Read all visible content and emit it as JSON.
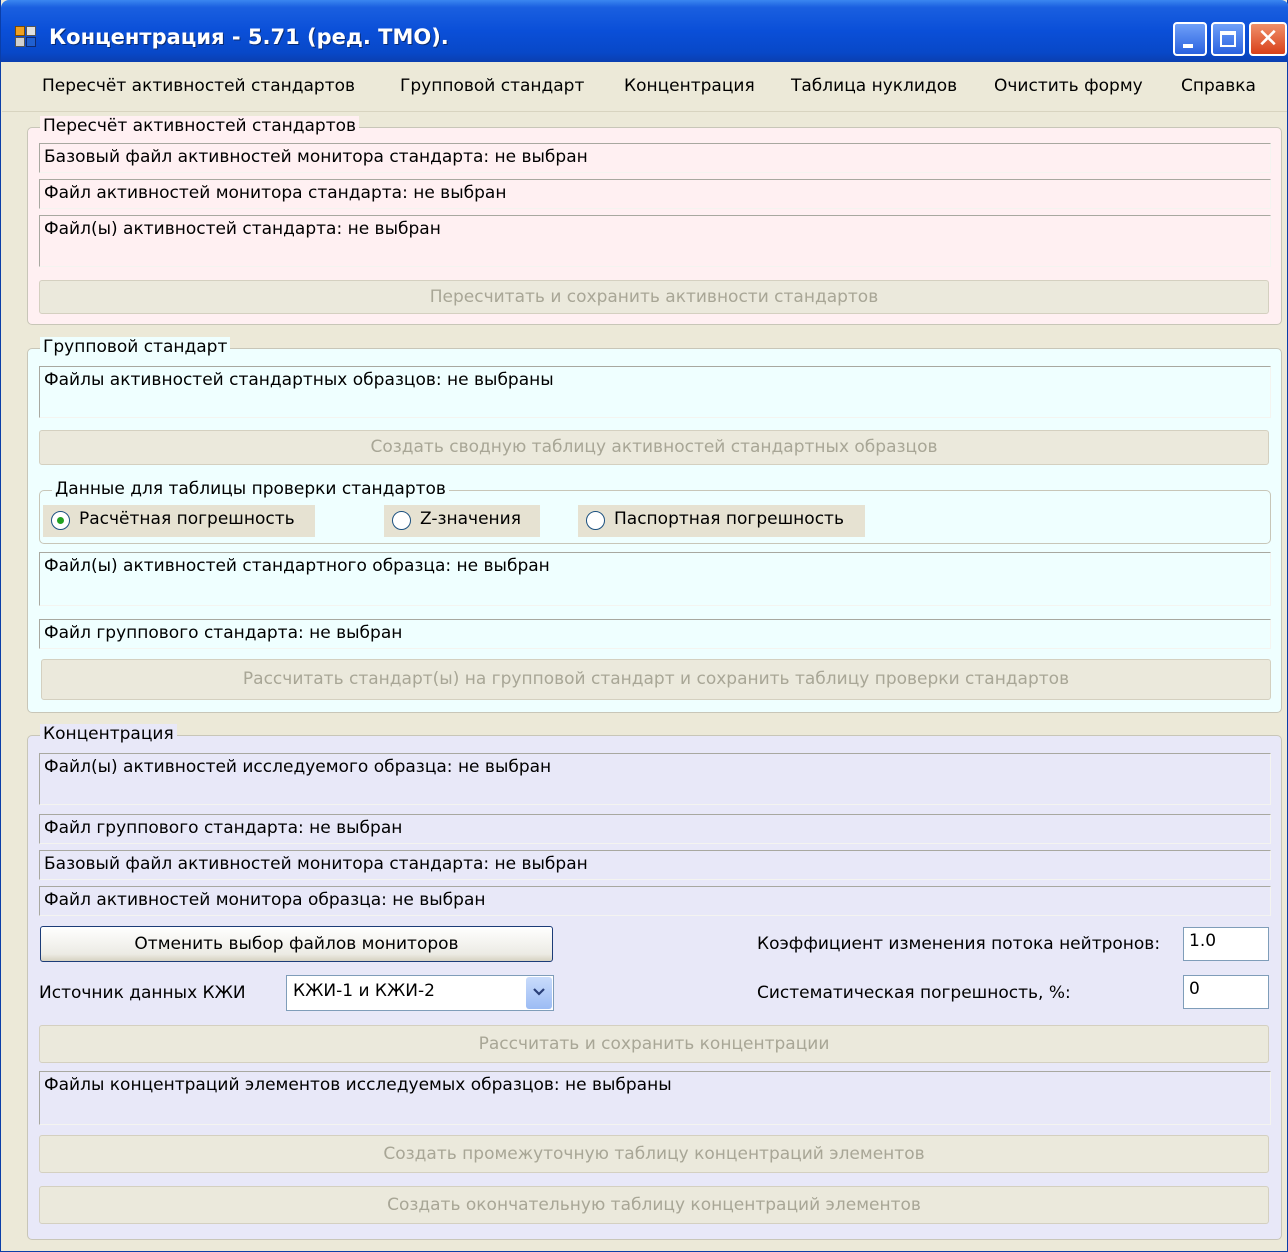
{
  "window": {
    "title": "Концентрация - 5.71 (ред. ТМО).",
    "icons": [
      "app-icon",
      "minimize-icon",
      "maximize-icon",
      "close-icon"
    ]
  },
  "menu": {
    "items": [
      "Пересчёт активностей стандартов",
      "Групповой стандарт",
      "Концентрация",
      "Таблица нуклидов",
      "Очистить форму",
      "Справка"
    ]
  },
  "recalc": {
    "legend": "Пересчёт активностей стандартов",
    "base_monitor_file": "Базовый файл активностей монитора стандарта: не выбран",
    "monitor_file": "Файл активностей монитора стандарта: не выбран",
    "standard_files": "Файл(ы) активностей стандарта: не выбран",
    "recalc_button": "Пересчитать и сохранить активности стандартов"
  },
  "group": {
    "legend": "Групповой стандарт",
    "sample_files": "Файлы активностей стандартных образцов: не выбраны",
    "summary_button": "Создать сводную таблицу активностей стандартных образцов",
    "check_data": {
      "legend": "Данные для таблицы проверки стандартов",
      "options": [
        "Расчётная погрешность",
        "Z-значения",
        "Паспортная погрешность"
      ],
      "selected": "Расчётная погрешность"
    },
    "standard_sample_files": "Файл(ы) активностей стандартного образца: не выбран",
    "group_standard_file": "Файл группового стандарта: не выбран",
    "calc_button": "Рассчитать стандарт(ы) на групповой стандарт и сохранить таблицу проверки стандартов"
  },
  "conc": {
    "legend": "Концентрация",
    "studied_sample_files": "Файл(ы) активностей исследуемого образца: не выбран",
    "group_standard_file": "Файл группового стандарта: не выбран",
    "base_monitor_file": "Базовый файл активностей монитора стандарта: не выбран",
    "sample_monitor_file": "Файл активностей монитора образца: не выбран",
    "cancel_monitors_button": "Отменить выбор файлов мониторов",
    "neutron_flux_label": "Коэффициент изменения потока нейтронов:",
    "neutron_flux_value": "1.0",
    "kzhi_label": "Источник данных КЖИ",
    "kzhi_value": "КЖИ-1 и КЖИ-2",
    "systematic_label": "Систематическая погрешность, %:",
    "systematic_value": "0",
    "calc_button": "Рассчитать и сохранить концентрации",
    "conc_files": "Файлы концентраций элементов исследуемых образцов: не выбраны",
    "intermediate_button": "Создать промежуточную таблицу концентраций элементов",
    "final_button": "Создать окончательную таблицу концентраций элементов"
  },
  "colors": {
    "titlebar": "#0a4fd8",
    "recalc_bg": "#fff0f2",
    "group_bg": "#efffff",
    "conc_bg": "#e8e8f8",
    "radio_selected": "#21a121"
  }
}
